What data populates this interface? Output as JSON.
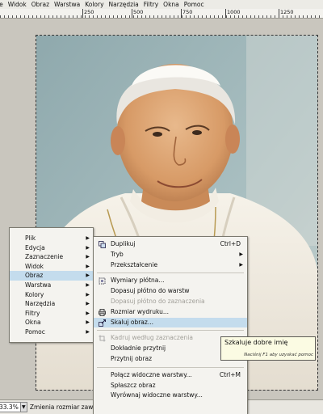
{
  "menubar": {
    "items": [
      "ie",
      "Widok",
      "Obraz",
      "Warstwa",
      "Kolory",
      "Narzędzia",
      "Filtry",
      "Okna",
      "Pomoc"
    ]
  },
  "ruler": {
    "labels": [
      "250",
      "500",
      "750",
      "1000",
      "1250"
    ]
  },
  "statusbar": {
    "zoom": "33.3%",
    "message": "Zmienia rozmiar zawartości"
  },
  "context_menu": {
    "items": [
      {
        "label": "Plik",
        "submenu": true
      },
      {
        "label": "Edycja",
        "submenu": true
      },
      {
        "label": "Zaznaczenie",
        "submenu": true
      },
      {
        "label": "Widok",
        "submenu": true
      },
      {
        "label": "Obraz",
        "submenu": true,
        "selected": true
      },
      {
        "label": "Warstwa",
        "submenu": true
      },
      {
        "label": "Kolory",
        "submenu": true
      },
      {
        "label": "Narzędzia",
        "submenu": true
      },
      {
        "label": "Filtry",
        "submenu": true
      },
      {
        "label": "Okna",
        "submenu": true
      },
      {
        "label": "Pomoc",
        "submenu": true
      }
    ]
  },
  "image_menu": {
    "groups": [
      [
        {
          "label": "Duplikuj",
          "shortcut": "Ctrl+D",
          "icon": "duplicate-icon"
        },
        {
          "label": "Tryb",
          "submenu": true
        },
        {
          "label": "Przekształcenie",
          "submenu": true
        }
      ],
      [
        {
          "label": "Wymiary płótna...",
          "icon": "canvas-size-icon"
        },
        {
          "label": "Dopasuj płótno do warstw"
        },
        {
          "label": "Dopasuj płótno do zaznaczenia",
          "disabled": true
        },
        {
          "label": "Rozmiar wydruku...",
          "icon": "print-size-icon"
        },
        {
          "label": "Skaluj obraz...",
          "icon": "scale-icon",
          "selected": true
        }
      ],
      [
        {
          "label": "Kadruj według zaznaczenia",
          "icon": "crop-icon",
          "disabled": true
        },
        {
          "label": "Dokładnie przytnij"
        },
        {
          "label": "Przytnij obraz"
        }
      ],
      [
        {
          "label": "Połącz widoczne warstwy...",
          "shortcut": "Ctrl+M"
        },
        {
          "label": "Spłaszcz obraz"
        },
        {
          "label": "Wyrównaj widoczne warstwy..."
        }
      ]
    ]
  },
  "tooltip": {
    "title": "Szkaluje dobre imię",
    "hint": "Naciśnij F1 aby uzyskać pomoc"
  }
}
